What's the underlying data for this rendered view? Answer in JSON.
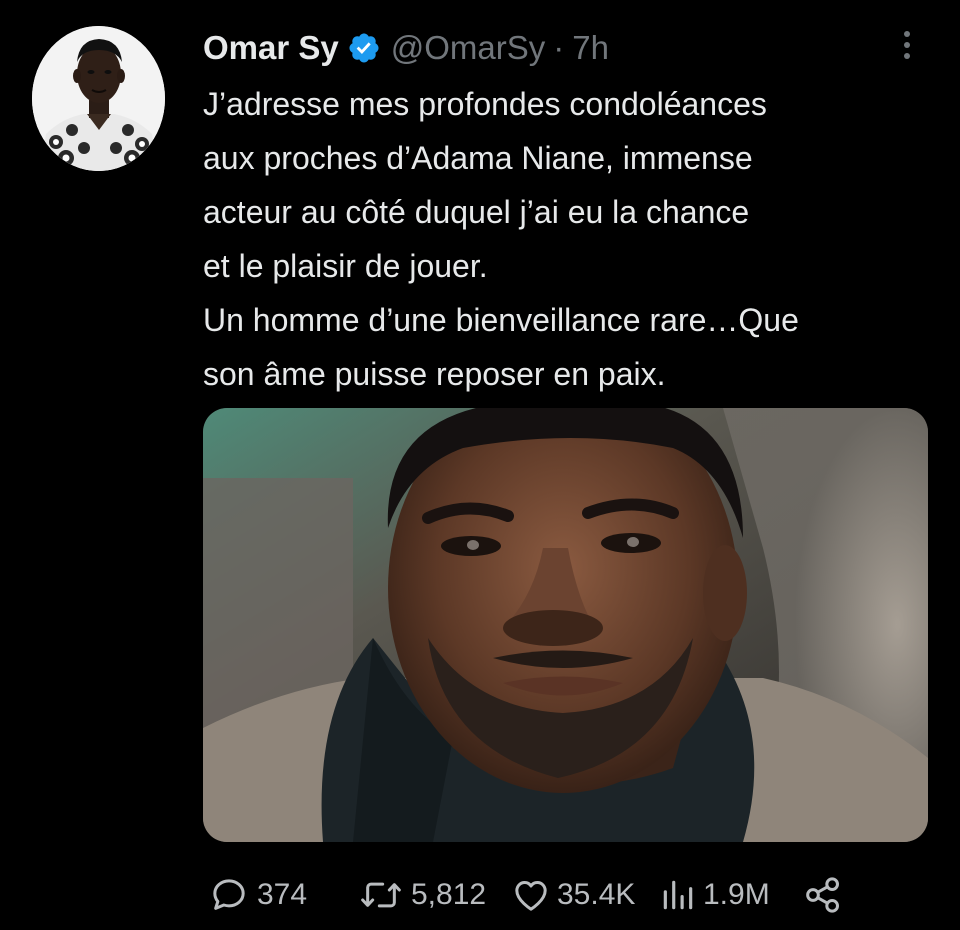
{
  "tweet": {
    "author": {
      "display_name": "Omar Sy",
      "handle": "@OmarSy",
      "verified": true,
      "avatar_icon": "profile-photo"
    },
    "separator": "·",
    "time": "7h",
    "text_lines": [
      "J’adresse mes profondes condoléances",
      "aux proches d’Adama Niane, immense",
      "acteur au côté duquel j’ai eu la chance",
      "et le plaisir de jouer.",
      "Un homme d’une bienveillance rare…Que",
      "son âme puisse reposer en paix."
    ],
    "media": {
      "kind": "photo"
    },
    "actions": {
      "replies": "374",
      "retweets": "5,812",
      "likes": "35.4K",
      "views": "1.9M"
    }
  },
  "colors": {
    "background": "#000000",
    "text": "#e7e9ea",
    "muted": "#71767b",
    "verified_badge": "#1d9bf0",
    "action_icons": "#b9bcbf"
  },
  "icons": {
    "more": "more-vertical-icon",
    "verified": "verified-badge-icon",
    "reply": "reply-icon",
    "retweet": "retweet-icon",
    "like": "heart-icon",
    "views": "views-bar-chart-icon",
    "share": "share-icon"
  }
}
